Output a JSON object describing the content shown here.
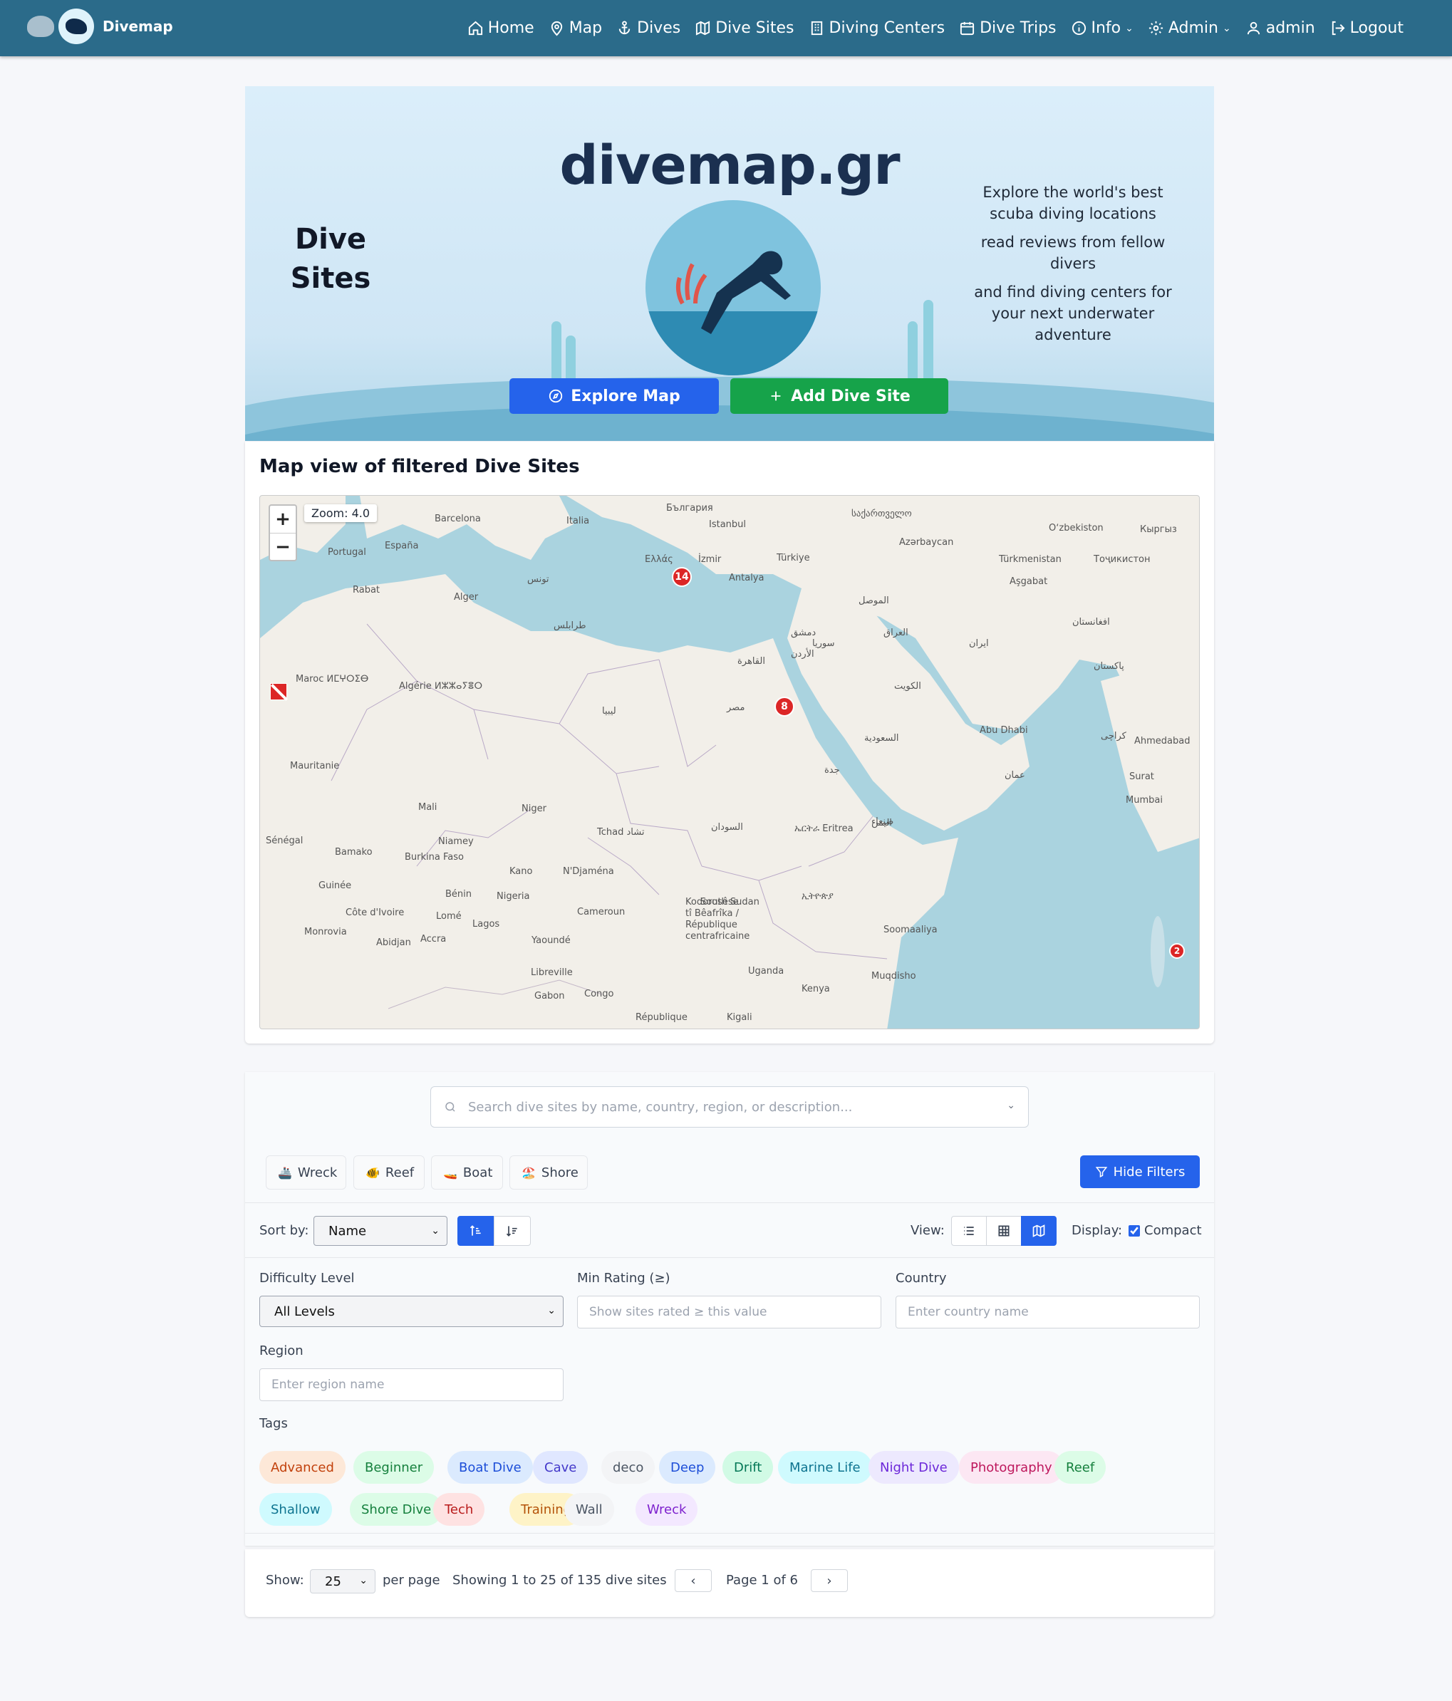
{
  "nav": {
    "brand": "Divemap",
    "items": [
      {
        "label": "Home",
        "icon": "home-icon"
      },
      {
        "label": "Map",
        "icon": "map-pin-icon"
      },
      {
        "label": "Dives",
        "icon": "anchor-icon"
      },
      {
        "label": "Dive Sites",
        "icon": "map-icon"
      },
      {
        "label": "Diving Centers",
        "icon": "building-icon"
      },
      {
        "label": "Dive Trips",
        "icon": "calendar-icon"
      },
      {
        "label": "Info",
        "icon": "info-icon"
      },
      {
        "label": "Admin",
        "icon": "gear-icon"
      },
      {
        "label": "admin",
        "icon": "user-icon"
      },
      {
        "label": "Logout",
        "icon": "logout-icon"
      }
    ]
  },
  "hero": {
    "brand_title": "divemap.gr",
    "side_title_1": "Dive",
    "side_title_2": "Sites",
    "desc": [
      "Explore the world's best scuba diving locations",
      "read reviews from fellow divers",
      "and find diving centers for your next underwater adventure"
    ],
    "explore_btn": "Explore Map",
    "add_btn": "Add Dive Site"
  },
  "map": {
    "heading": "Map view of filtered Dive Sites",
    "zoom_label": "Zoom: 4.0",
    "zoom_in": "+",
    "zoom_out": "−",
    "markers": [
      {
        "count": "14"
      },
      {
        "count": "8"
      },
      {
        "count": "2"
      }
    ],
    "place_labels": [
      "Barcelona",
      "Italia",
      "България",
      "Istanbul",
      "საქართველო",
      "Portugal",
      "España",
      "Ελλάς",
      "İzmir",
      "Türkiye",
      "Azərbaycan",
      "Oʻzbekiston",
      "Кыргыз",
      "Rabat",
      "Alger",
      "تونس",
      "Antalya",
      "Türkmenistan",
      "Тоҷикистон",
      "Aşgabat",
      "Maroc ⵍⵎⵖⵔⵉⴱ",
      "Algérie ⵍⵣⵣⴰⵢⴻⵔ",
      "طرابلس",
      "ليبيا",
      "مصر",
      "القاهرة",
      "سوريا",
      "العراق",
      "ایران",
      "افغانستان",
      "پاکستان",
      "دمشق",
      "الأردن",
      "الموصل",
      "السعودية",
      "عمان",
      "Mauritanie",
      "Mali",
      "Niger",
      "Tchad تشاد",
      "السودان",
      "ኤርትራ Eritrea",
      "اليمن",
      "Ahmedabad",
      "Surat",
      "Mumbai",
      "Sénégal",
      "Bamako",
      "Burkina Faso",
      "Niamey",
      "Kano",
      "N'Djaména",
      "Guinée",
      "Côte d'Ivoire",
      "Nigeria",
      "Bénin",
      "Lomé",
      "Lagos",
      "Cameroun",
      "Kodorosêse tî Bêafrîka / République centrafricaine",
      "South Sudan",
      "ኢትዮጵያ",
      "Soomaaliya",
      "Monrovia",
      "Abidjan",
      "Accra",
      "Yaoundé",
      "Libreville",
      "Gabon",
      "Congo",
      "Uganda",
      "Kenya",
      "Muqdisho",
      "République",
      "Kigali",
      "كراچی",
      "جدة",
      "صنعاء",
      "Abu Dhabi",
      "الكويت"
    ]
  },
  "filters": {
    "search_placeholder": "Search dive sites by name, country, region, or description...",
    "quick": [
      {
        "icon": "ship-icon",
        "emoji": "🚢",
        "label": "Wreck"
      },
      {
        "icon": "fish-icon",
        "emoji": "🐠",
        "label": "Reef"
      },
      {
        "icon": "boat-icon",
        "emoji": "🚤",
        "label": "Boat"
      },
      {
        "icon": "beach-icon",
        "emoji": "🏖️",
        "label": "Shore"
      }
    ],
    "hide_btn": "Hide Filters",
    "sort_label": "Sort by:",
    "sort_value": "Name",
    "view_label": "View:",
    "display_label": "Display:",
    "compact_label": "Compact",
    "compact_checked": true,
    "difficulty_label": "Difficulty Level",
    "difficulty_value": "All Levels",
    "rating_label": "Min Rating (≥)",
    "rating_placeholder": "Show sites rated ≥ this value",
    "country_label": "Country",
    "country_placeholder": "Enter country name",
    "region_label": "Region",
    "region_placeholder": "Enter region name",
    "tags_label": "Tags",
    "tags": [
      {
        "label": "Advanced",
        "bg": "#fde8d8",
        "fg": "#c2410c"
      },
      {
        "label": "Beginner",
        "bg": "#dcfce7",
        "fg": "#15803d"
      },
      {
        "label": "Boat Dive",
        "bg": "#dbeafe",
        "fg": "#1d4ed8"
      },
      {
        "label": "Cave",
        "bg": "#e0e7ff",
        "fg": "#4338ca"
      },
      {
        "label": "deco",
        "bg": "#f3f4f6",
        "fg": "#4b5563"
      },
      {
        "label": "Deep",
        "bg": "#dbeafe",
        "fg": "#1d4ed8"
      },
      {
        "label": "Drift",
        "bg": "#d1fae5",
        "fg": "#047857"
      },
      {
        "label": "Marine Life",
        "bg": "#cffafe",
        "fg": "#0e7490"
      },
      {
        "label": "Night Dive",
        "bg": "#ede9fe",
        "fg": "#6d28d9"
      },
      {
        "label": "Photography",
        "bg": "#fce7f3",
        "fg": "#be185d"
      },
      {
        "label": "Reef",
        "bg": "#dcfce7",
        "fg": "#15803d"
      },
      {
        "label": "Shallow",
        "bg": "#cffafe",
        "fg": "#0e7490"
      },
      {
        "label": "Shore Dive",
        "bg": "#dcfce7",
        "fg": "#15803d"
      },
      {
        "label": "Tech",
        "bg": "#fee2e2",
        "fg": "#b91c1c"
      },
      {
        "label": "Training",
        "bg": "#fef3c7",
        "fg": "#b45309"
      },
      {
        "label": "Wall",
        "bg": "#f3f4f6",
        "fg": "#4b5563"
      },
      {
        "label": "Wreck",
        "bg": "#f3e8ff",
        "fg": "#7e22ce"
      }
    ]
  },
  "pager": {
    "show_label": "Show:",
    "per_page_value": "25",
    "per_page_label": "per page",
    "summary": "Showing 1 to 25 of 135 dive sites",
    "page_text": "Page 1 of 6",
    "prev": "‹",
    "next": "›"
  }
}
